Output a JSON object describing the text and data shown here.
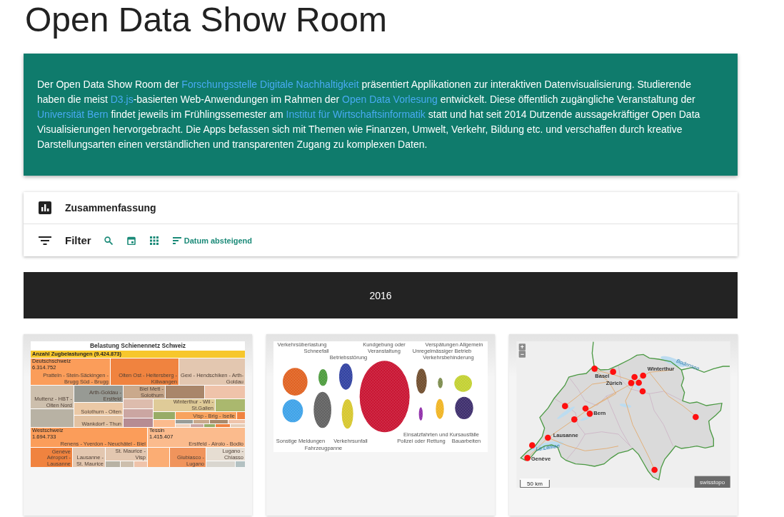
{
  "page_title": "Open Data Show Room",
  "intro": [
    {
      "kind": "plain",
      "text": "Der Open Data Show Room der "
    },
    {
      "kind": "link",
      "text": "Forschungsstelle Digitale Nachhaltigkeit"
    },
    {
      "kind": "plain",
      "text": " präsentiert Applikationen zur interaktiven Datenvisualisierung. Studierende haben die meist "
    },
    {
      "kind": "link",
      "text": "D3.js"
    },
    {
      "kind": "plain",
      "text": "-basierten Web-Anwendungen im Rahmen der "
    },
    {
      "kind": "link",
      "text": "Open Data Vorlesung"
    },
    {
      "kind": "plain",
      "text": " entwickelt. Diese öffentlich zugängliche Veranstaltung der "
    },
    {
      "kind": "link",
      "text": "Universität Bern"
    },
    {
      "kind": "plain",
      "text": " findet jeweils im Frühlingssemester am "
    },
    {
      "kind": "link",
      "text": "Institut für Wirtschaftsinformatik"
    },
    {
      "kind": "plain",
      "text": " statt und hat seit 2014 Dutzende aussagekräftiger Open Data Visualisierungen hervorgebracht. Die Apps befassen sich mit Themen wie Finanzen, Umwelt, Verkehr, Bildung etc. und verschaffen durch kreative Darstellungsarten einen verständlichen und transparenten Zugang zu komplexen Daten."
    }
  ],
  "summary": {
    "title": "Zusammenfassung"
  },
  "filter_bar": {
    "label": "Filter",
    "sort_label": "Datum absteigend"
  },
  "year": "2016",
  "cards": [
    {
      "kind": "treemap",
      "title": "Belastung Schienennetz Schweiz",
      "header": "Anzahl Zugbelastungen (9.424.873)",
      "regions": [
        {
          "name": "Deutschschweiz",
          "total": "6.314.752"
        },
        {
          "name": "Westschweiz",
          "total": "1.694.733"
        },
        {
          "name": "Tessin",
          "total": "1.415.407"
        }
      ],
      "routes": [
        "Pratteln - Stein-Säckingen - Brugg Süd - Brugg",
        "Olten Ost - Heitersberg - Killwangen",
        "Gexi - Hendschiken - Arth-Goldau",
        "Muttenz - HBT - Olten Nord",
        "Arth-Goldau - Erstfeld",
        "Biel Mett - Solothurn",
        "Winterthur - Wil - St.Gallen",
        "Visp - Brig - Iselle",
        "Solothurn - Olten",
        "Wankdorf - Thun",
        "Renens - Yverdon - Neuchâtel - Biel",
        "Genève Aéroport - Lausanne",
        "Lausanne - St. Maurice",
        "St. Maurice - Visp",
        "Erstfeld - Airolo - Bodio",
        "Giubiasco - Lugano",
        "Lugano - Chiasso"
      ]
    },
    {
      "kind": "clusters",
      "labels": [
        "Verkehrsüberlastung",
        "Schneefall",
        "Betriebsstörung",
        "Kundgebung oder Veranstaltung",
        "Verspätungen Allgemein",
        "Unregelmässiger Betrieb",
        "Verkehrsbehinderung",
        "Einsatzfahrten und Kursausfälle",
        "Sonstige Meldungen",
        "Fahrzeugpanne",
        "Verkehrsunfall",
        "Polizei oder Rettung",
        "Bauarbeiten"
      ]
    },
    {
      "kind": "map",
      "zoom_buttons": [
        "+",
        "−"
      ],
      "lakes": [
        "Bodensee",
        "Le Léman"
      ],
      "cities": [
        "Basel",
        "Winterthur",
        "Zürich",
        "Bern",
        "Lausanne",
        "Genève"
      ],
      "scale": "50 km",
      "attribution": "swisstopo"
    }
  ]
}
